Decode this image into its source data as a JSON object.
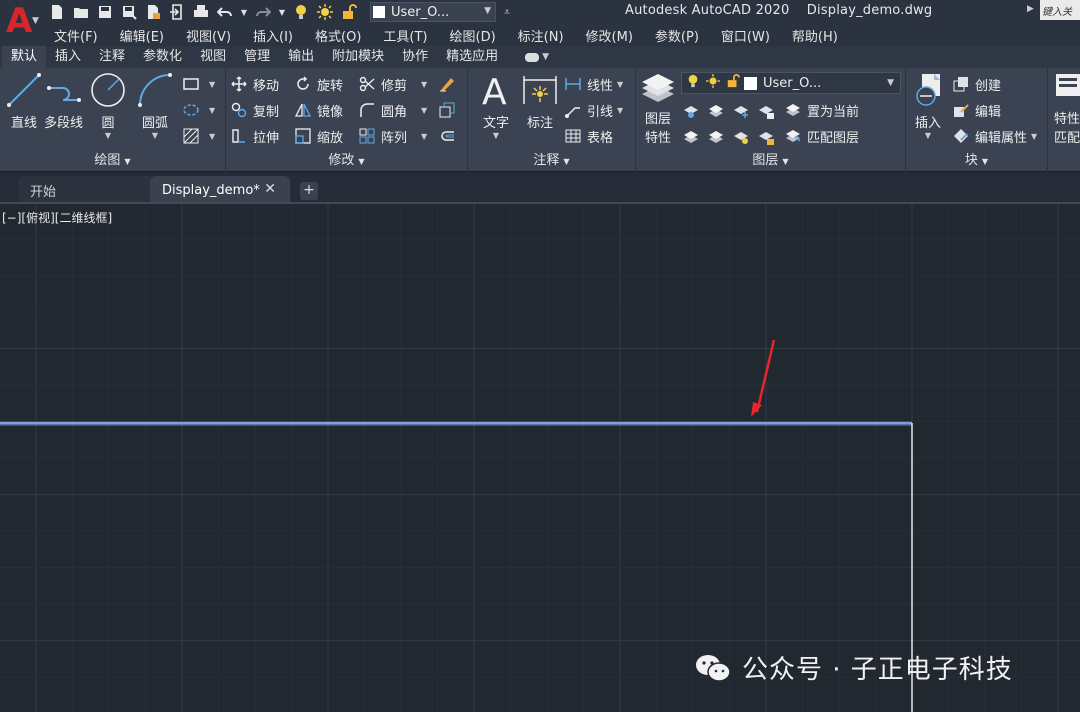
{
  "app": {
    "logo_letter": "A",
    "title": "Autodesk AutoCAD 2020    Display_demo.dwg",
    "search_placeholder": "键入关",
    "layer_current": "User_O..."
  },
  "menu": [
    "文件(F)",
    "编辑(E)",
    "视图(V)",
    "插入(I)",
    "格式(O)",
    "工具(T)",
    "绘图(D)",
    "标注(N)",
    "修改(M)",
    "参数(P)",
    "窗口(W)",
    "帮助(H)"
  ],
  "ribbon_tabs": [
    "默认",
    "插入",
    "注释",
    "参数化",
    "视图",
    "管理",
    "输出",
    "附加模块",
    "协作",
    "精选应用"
  ],
  "ribbon": {
    "draw": {
      "label": "绘图",
      "line": "直线",
      "polyline": "多段线",
      "circle": "圆",
      "arc": "圆弧"
    },
    "modify": {
      "label": "修改",
      "move": "移动",
      "rotate": "旋转",
      "trim": "修剪",
      "copy": "复制",
      "mirror": "镜像",
      "fillet": "圆角",
      "stretch": "拉伸",
      "scale": "缩放",
      "array": "阵列"
    },
    "annotation": {
      "label": "注释",
      "text": "文字",
      "dimension": "标注",
      "linear": "线性",
      "leader": "引线",
      "table": "表格"
    },
    "layers": {
      "label": "图层",
      "properties_line1": "图层",
      "properties_line2": "特性",
      "layer_current": "User_O...",
      "set_current": "置为当前",
      "match_layer": "匹配图层"
    },
    "block": {
      "label": "块",
      "insert": "插入",
      "create": "创建",
      "edit": "编辑",
      "edit_attributes": "编辑属性"
    },
    "properties": {
      "line1": "特性",
      "line2": "匹配"
    }
  },
  "doc_tabs": [
    {
      "label": "开始"
    },
    {
      "label": "Display_demo*"
    }
  ],
  "viewport_label": "[−][俯视][二维线框]",
  "watermark": "公众号 · 子正电子科技",
  "colors": {
    "canvas_bg": "#212830",
    "grid_major": "#2f3845",
    "grid_minor": "#262e39",
    "selected_line": "#7d9fe8",
    "annotation_arrow": "#e8262b",
    "white_line": "#e8e8e8"
  }
}
